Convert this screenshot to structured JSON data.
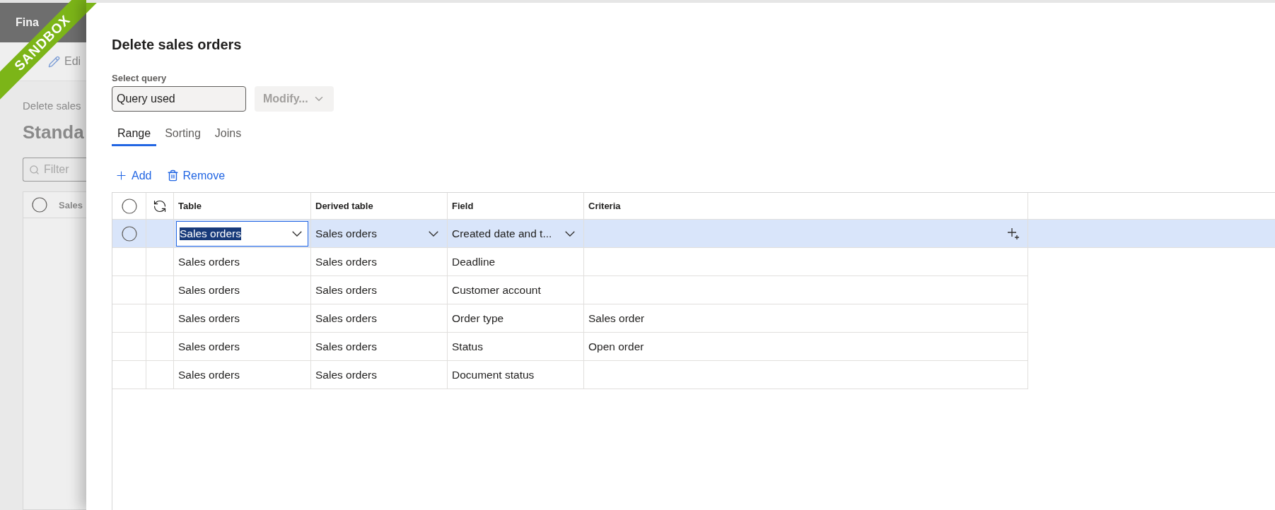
{
  "background_page": {
    "header_title": "Fina",
    "toolbar_button": "Edi",
    "breadcrumb": "Delete sales",
    "heading": "Standa",
    "filter": {
      "placeholder": "Filter"
    },
    "list_column": "Sales",
    "select_all": {
      "checked": false
    }
  },
  "ribbon": {
    "label": "SANDBOX"
  },
  "dialog": {
    "title": "Delete sales orders",
    "select_query": {
      "label": "Select query",
      "value": "Query used"
    },
    "modify_button": {
      "label": "Modify...",
      "disabled": true
    },
    "tabs": [
      {
        "label": "Range",
        "selected": true
      },
      {
        "label": "Sorting",
        "selected": false
      },
      {
        "label": "Joins",
        "selected": false
      }
    ],
    "actions": [
      {
        "kind": "add",
        "label": "Add"
      },
      {
        "kind": "remove",
        "label": "Remove"
      }
    ],
    "table": {
      "select_all": {
        "checked": false
      },
      "columns": [
        "Table",
        "Derived table",
        "Field",
        "Criteria"
      ],
      "rows": [
        {
          "selected": true,
          "table": "Sales orders",
          "derived_table": "Sales orders",
          "field": "Created date and t..."
        },
        {
          "selected": false,
          "table": "Sales orders",
          "derived_table": "Sales orders",
          "field": "Deadline"
        },
        {
          "selected": false,
          "table": "Sales orders",
          "derived_table": "Sales orders",
          "field": "Customer account"
        },
        {
          "selected": false,
          "table": "Sales orders",
          "derived_table": "Sales orders",
          "field": "Order type",
          "criteria": "Sales order"
        },
        {
          "selected": false,
          "table": "Sales orders",
          "derived_table": "Sales orders",
          "field": "Status",
          "criteria": "Open order"
        },
        {
          "selected": false,
          "table": "Sales orders",
          "derived_table": "Sales orders",
          "field": "Document status"
        }
      ]
    }
  }
}
